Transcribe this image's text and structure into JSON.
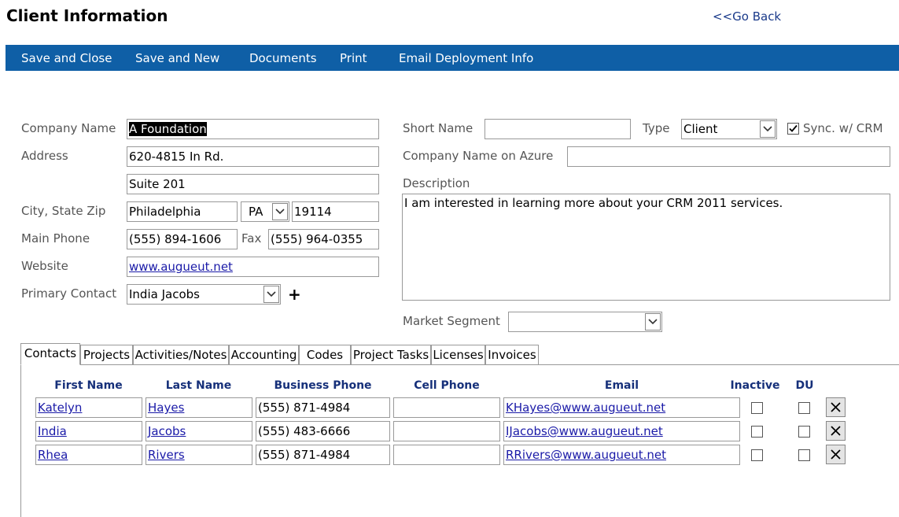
{
  "page": {
    "title": "Client Information",
    "go_back": "<<Go Back"
  },
  "toolbar": {
    "save_close": "Save and Close",
    "save_new": "Save and New",
    "documents": "Documents",
    "print": "Print",
    "email_deployment": "Email Deployment Info"
  },
  "form": {
    "company_name_label": "Company Name",
    "company_name_value": "A Foundation",
    "address_label": "Address",
    "address_line1": "620-4815 In Rd.",
    "address_line2": "Suite 201",
    "city_state_zip_label": "City, State Zip",
    "city": "Philadelphia",
    "state": "PA",
    "zip": "19114",
    "main_phone_label": "Main Phone",
    "main_phone": "(555) 894-1606",
    "fax_label": "Fax",
    "fax": "(555) 964-0355",
    "website_label": "Website",
    "website": "www.augueut.net",
    "primary_contact_label": "Primary Contact",
    "primary_contact": "India Jacobs",
    "add_contact_symbol": "+",
    "short_name_label": "Short Name",
    "short_name": "",
    "type_label": "Type",
    "type_value": "Client",
    "sync_crm_label": "Sync. w/ CRM",
    "sync_crm_checked": true,
    "azure_label": "Company Name on Azure",
    "azure_value": "",
    "description_label": "Description",
    "description": "I am interested in learning more about your CRM 2011 services.",
    "market_segment_label": "Market Segment",
    "market_segment": ""
  },
  "tabs": [
    {
      "label": "Contacts",
      "active": true
    },
    {
      "label": "Projects"
    },
    {
      "label": "Activities/Notes"
    },
    {
      "label": "Accounting"
    },
    {
      "label": "Codes"
    },
    {
      "label": "Project Tasks"
    },
    {
      "label": "Licenses"
    },
    {
      "label": "Invoices"
    }
  ],
  "contacts": {
    "headers": {
      "first_name": "First Name",
      "last_name": "Last Name",
      "business_phone": "Business Phone",
      "cell_phone": "Cell Phone",
      "email": "Email",
      "inactive": "Inactive",
      "du": "DU"
    },
    "rows": [
      {
        "first": "Katelyn",
        "last": "Hayes",
        "phone": "(555) 871-4984",
        "cell": "",
        "email": "KHayes@www.augueut.net"
      },
      {
        "first": "India",
        "last": "Jacobs",
        "phone": "(555) 483-6666",
        "cell": "",
        "email": "IJacobs@www.augueut.net"
      },
      {
        "first": "Rhea",
        "last": "Rivers",
        "phone": "(555) 871-4984",
        "cell": "",
        "email": "RRivers@www.augueut.net"
      }
    ]
  },
  "icons": {
    "dropdown": "chevron-down-icon",
    "delete": "close-icon",
    "check": "check-icon"
  },
  "colors": {
    "toolbar": "#0f5fa6",
    "link": "#1a1aa8",
    "header_text": "#16307a"
  }
}
